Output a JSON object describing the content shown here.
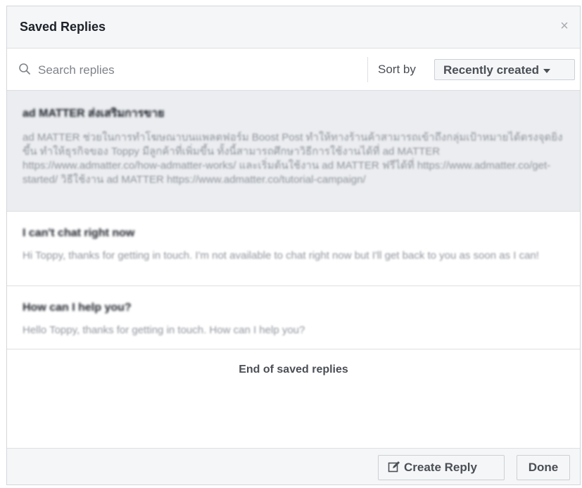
{
  "dialog": {
    "title": "Saved Replies",
    "close_glyph": "×"
  },
  "search": {
    "placeholder": "Search replies",
    "value": "",
    "icon": "search-icon"
  },
  "sort": {
    "label": "Sort by",
    "selected": "Recently created"
  },
  "replies": [
    {
      "title": "ad MATTER ส่งเสริมการขาย",
      "body": "ad MATTER ช่วยในการทำโฆษณาบนแพลตฟอร์ม Boost Post ทำให้ทางร้านค้าสามารถเข้าถึงกลุ่มเป้าหมายได้ตรงจุดยิ่งขึ้น ทำให้ธุรกิจของ Toppy มีลูกค้าที่เพิ่มขึ้น ทั้งนี้สามารถศึกษาวิธีการใช้งานได้ที่ ad MATTER https://www.admatter.co/how-admatter-works/ และเริ่มต้นใช้งาน ad MATTER ฟรีได้ที่ https://www.admatter.co/get-started/ วิธีใช้งาน ad MATTER https://www.admatter.co/tutorial-campaign/",
      "selected": true
    },
    {
      "title": "I can't chat right now",
      "body": "Hi Toppy, thanks for getting in touch. I'm not available to chat right now but I'll get back to you as soon as I can!",
      "selected": false
    },
    {
      "title": "How can I help you?",
      "body": "Hello Toppy, thanks for getting in touch. How can I help you?",
      "selected": false
    }
  ],
  "end_text": "End of saved replies",
  "footer": {
    "create_label": "Create Reply",
    "done_label": "Done"
  },
  "colors": {
    "header_bg": "#f5f6f7",
    "selected_row_bg": "#ebedf0",
    "border": "#dddfe2",
    "muted_text": "#90949c"
  }
}
